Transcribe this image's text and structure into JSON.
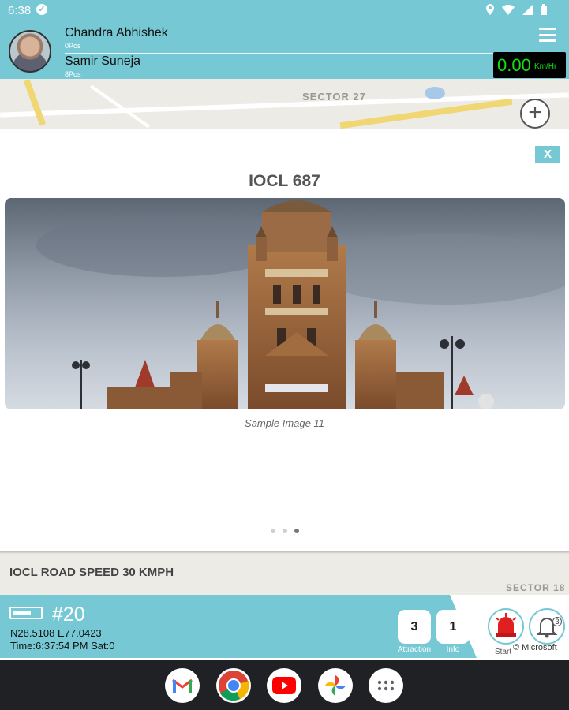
{
  "status_bar": {
    "time": "6:38"
  },
  "header": {
    "driver1_name": "Chandra  Abhishek",
    "driver1_pos": "0Pos",
    "driver2_name": "Samir  Suneja",
    "driver2_pos": "8Pos",
    "speed_value": "0.00",
    "speed_unit": "Km/Hr"
  },
  "map": {
    "sector_top": "SECTOR 27",
    "sector_bottom": "SECTOR 18",
    "road_speed": "IOCL ROAD SPEED 30 KMPH",
    "attribution": "© Microsoft"
  },
  "modal": {
    "close_label": "X",
    "title": "IOCL 687",
    "caption": "Sample Image 11",
    "page_count": 3,
    "active_page": 3
  },
  "bottom": {
    "vehicle_number": "#20",
    "coordinates": "N28.5108 E77.0423",
    "timeline": "Time:6:37:54 PM Sat:0",
    "attraction_count": "3",
    "attraction_label": "Attraction",
    "info_count": "1",
    "info_label": "Info",
    "start_label": "Start",
    "notification_badge": "3"
  },
  "colors": {
    "accent": "#76c9d4",
    "speed_text": "#12e012"
  },
  "nav_apps": [
    "gmail-icon",
    "chrome-icon",
    "youtube-icon",
    "photos-icon",
    "app-drawer-icon"
  ]
}
